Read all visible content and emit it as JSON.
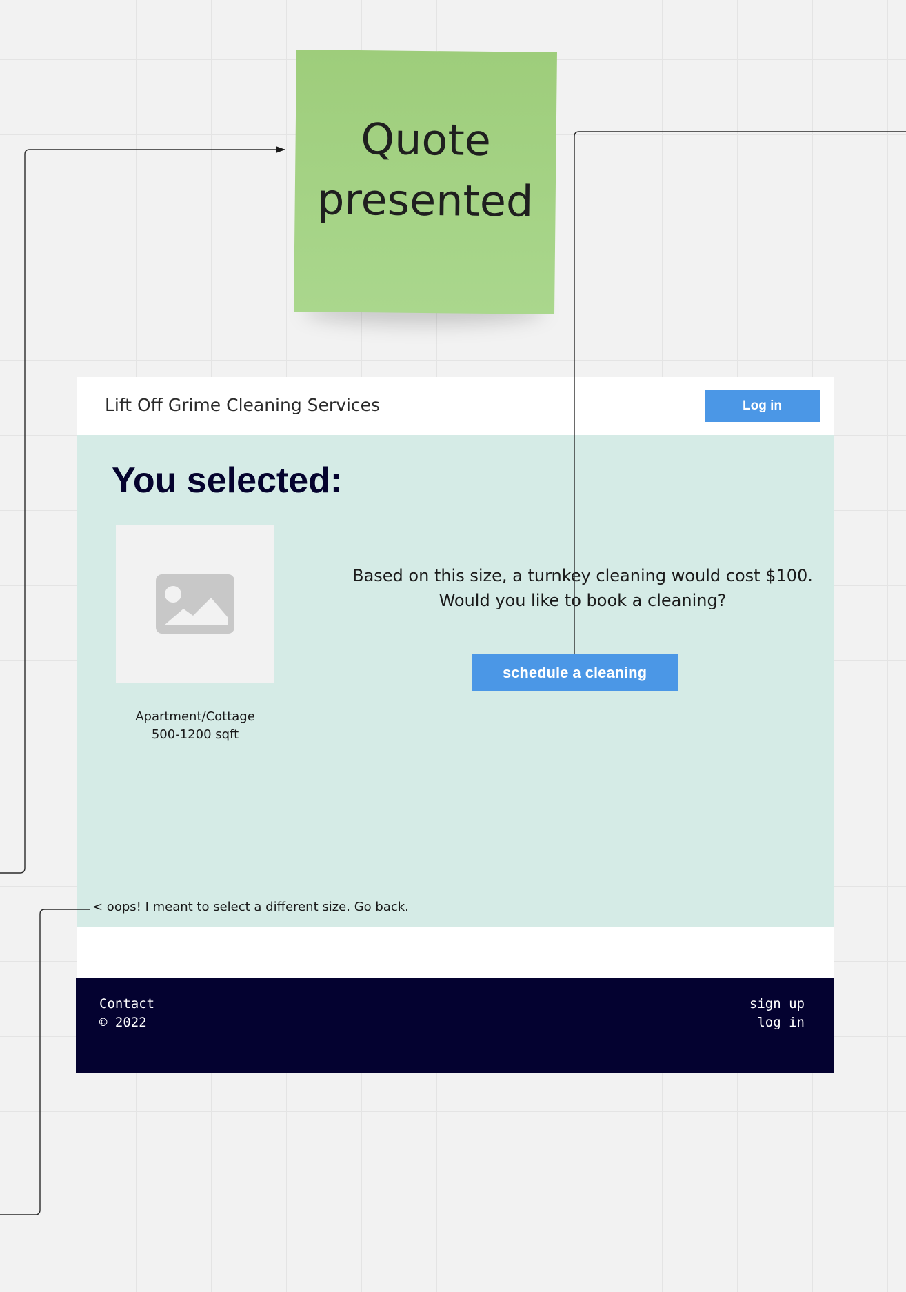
{
  "sticky_note": {
    "text": "Quote\npresented",
    "color": "#a4d282"
  },
  "wireframe": {
    "header": {
      "brand": "Lift Off Grime Cleaning Services",
      "login_button": "Log in"
    },
    "main": {
      "heading": "You selected:",
      "image_icon": "image-placeholder-icon",
      "selection_caption": "Apartment/Cottage\n500-1200 sqft",
      "quote_text": "Based on this size, a turnkey cleaning would cost $100. Would you like to book a cleaning?",
      "schedule_button": "schedule a cleaning",
      "back_link": "< oops! I meant to select a different size. Go back."
    },
    "footer": {
      "contact": "Contact",
      "copyright": "© 2022",
      "sign_up": "sign up",
      "log_in": "log in"
    }
  },
  "colors": {
    "button_blue": "#4b97e6",
    "content_background": "#d5ebe6",
    "heading_navy": "#05032e",
    "footer_navy": "#040230"
  }
}
